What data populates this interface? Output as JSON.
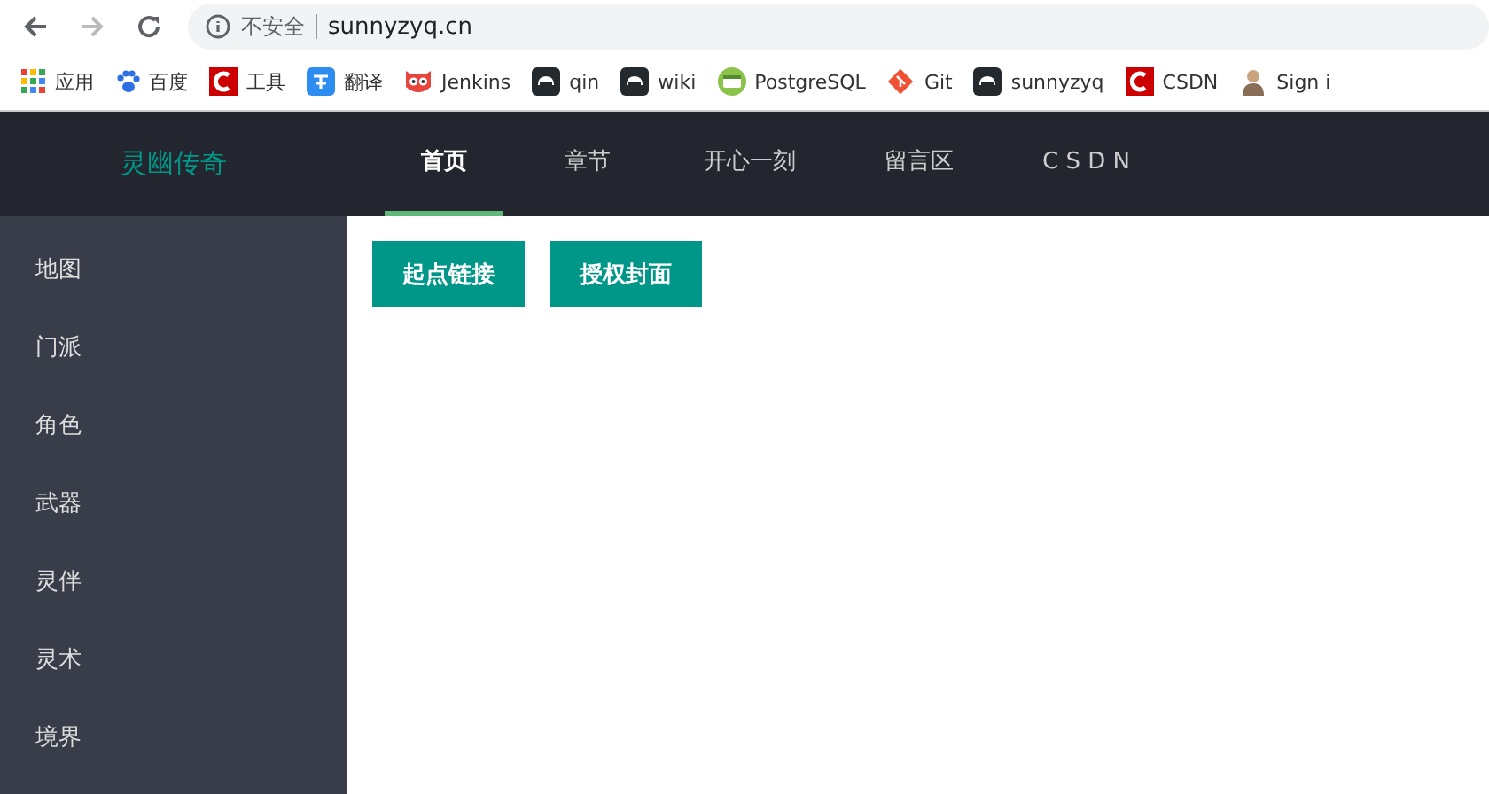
{
  "browser": {
    "security_label": "不安全",
    "url": "sunnyzyq.cn"
  },
  "bookmarks": [
    {
      "label": "应用",
      "kind": "apps"
    },
    {
      "label": "百度",
      "kind": "paw"
    },
    {
      "label": "工具",
      "kind": "c"
    },
    {
      "label": "翻译",
      "kind": "translate"
    },
    {
      "label": "Jenkins",
      "kind": "owl"
    },
    {
      "label": "qin",
      "kind": "cat"
    },
    {
      "label": "wiki",
      "kind": "cat"
    },
    {
      "label": "PostgreSQL",
      "kind": "web"
    },
    {
      "label": "Git",
      "kind": "git"
    },
    {
      "label": "sunnyzyq",
      "kind": "cat"
    },
    {
      "label": "CSDN",
      "kind": "c"
    },
    {
      "label": "Sign i",
      "kind": "person"
    }
  ],
  "header": {
    "logo": "灵幽传奇",
    "nav": [
      {
        "label": "首页",
        "selected": true
      },
      {
        "label": "章节",
        "selected": false
      },
      {
        "label": "开心一刻",
        "selected": false
      },
      {
        "label": "留言区",
        "selected": false
      },
      {
        "label": "C S D N",
        "selected": false
      }
    ]
  },
  "sidebar": {
    "items": [
      "地图",
      "门派",
      "角色",
      "武器",
      "灵伴",
      "灵术",
      "境界"
    ]
  },
  "content": {
    "buttons": [
      "起点链接",
      "授权封面"
    ]
  }
}
